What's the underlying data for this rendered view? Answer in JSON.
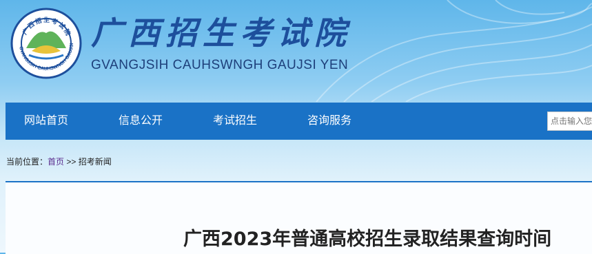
{
  "header": {
    "title_cn": "广西招生考试院",
    "title_en": "GVANGJSIH CAUHSWNGH GAUJSI YEN",
    "emblem_ring_text": "GVANGJSIH CAUHSWNGH GAUJSI YEN",
    "emblem_top_text": "广西招生考试院"
  },
  "nav": {
    "items": [
      {
        "label": "网站首页"
      },
      {
        "label": "信息公开"
      },
      {
        "label": "考试招生"
      },
      {
        "label": "咨询服务"
      }
    ]
  },
  "search": {
    "placeholder": "点击输入您"
  },
  "breadcrumb": {
    "prefix": "当前位置：",
    "home": "首页",
    "sep": " >> ",
    "current": "招考新闻"
  },
  "article": {
    "title": "广西2023年普通高校招生录取结果查询时间"
  },
  "colors": {
    "nav_bg": "#1a72c6",
    "title_blue": "#1d4f9c",
    "link_purple": "#5b2d8e"
  }
}
